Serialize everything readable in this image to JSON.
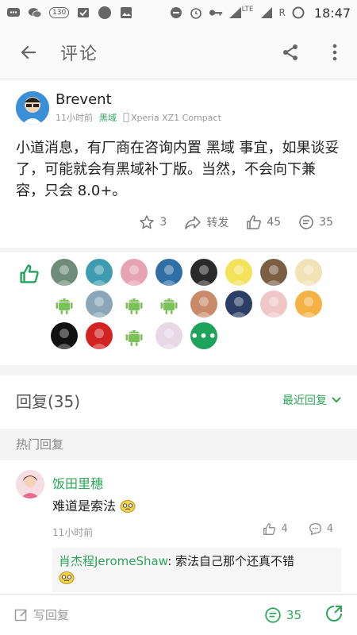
{
  "status_bar": {
    "time": "18:47",
    "badge": "130",
    "net_label": "LTE",
    "roaming": "R"
  },
  "app_bar": {
    "title": "评论"
  },
  "post": {
    "author": "Brevent",
    "time": "11小时前",
    "category": "黑域",
    "device": "Xperia XZ1 Compact",
    "body": "小道消息，有厂商在咨询内置 黑域 事宜，如果谈妥了，可能就会有黑域补丁版。当然，不会向下兼容，只会 8.0+。",
    "likes": "3",
    "forward_label": "转发",
    "upvotes": "45",
    "comments": "35"
  },
  "likers": [
    {
      "type": "photo",
      "color": "#6f8c7a"
    },
    {
      "type": "photo",
      "color": "#3e9bb0"
    },
    {
      "type": "photo",
      "color": "#e6a3b3"
    },
    {
      "type": "photo",
      "color": "#2f6fa6"
    },
    {
      "type": "photo",
      "color": "#2a2a2a"
    },
    {
      "type": "photo",
      "color": "#f3e35a"
    },
    {
      "type": "photo",
      "color": "#7a5f45"
    },
    {
      "type": "photo",
      "color": "#f1e3b5"
    },
    {
      "type": "android",
      "color": "#78c257"
    },
    {
      "type": "photo",
      "color": "#8aa6b8"
    },
    {
      "type": "android",
      "color": "#78c257"
    },
    {
      "type": "android",
      "color": "#78c257"
    },
    {
      "type": "photo",
      "color": "#c98a6a"
    },
    {
      "type": "photo",
      "color": "#2b3f66"
    },
    {
      "type": "photo",
      "color": "#efc7c7"
    },
    {
      "type": "photo",
      "color": "#f4b244"
    },
    {
      "type": "photo",
      "color": "#111111"
    },
    {
      "type": "photo",
      "color": "#d32222"
    },
    {
      "type": "android",
      "color": "#78c257"
    },
    {
      "type": "photo",
      "color": "#e7d8e6"
    }
  ],
  "more_likers_label": "•••",
  "replies": {
    "heading": "回复(35)",
    "sort_label": "最近回复",
    "hot_label": "热门回复"
  },
  "comment": {
    "name": "饭田里穗",
    "body": "难道是索法",
    "time": "11小时前",
    "upvotes": "4",
    "replies": "4",
    "sub_reply_name": "肖杰程JeromeShaw",
    "sub_reply_text": ": 索法自己那个还真不错"
  },
  "bottom_bar": {
    "write_label": "写回复",
    "comment_count": "35"
  },
  "colors": {
    "accent": "#2da65a",
    "brand_green": "#1fa35c"
  }
}
